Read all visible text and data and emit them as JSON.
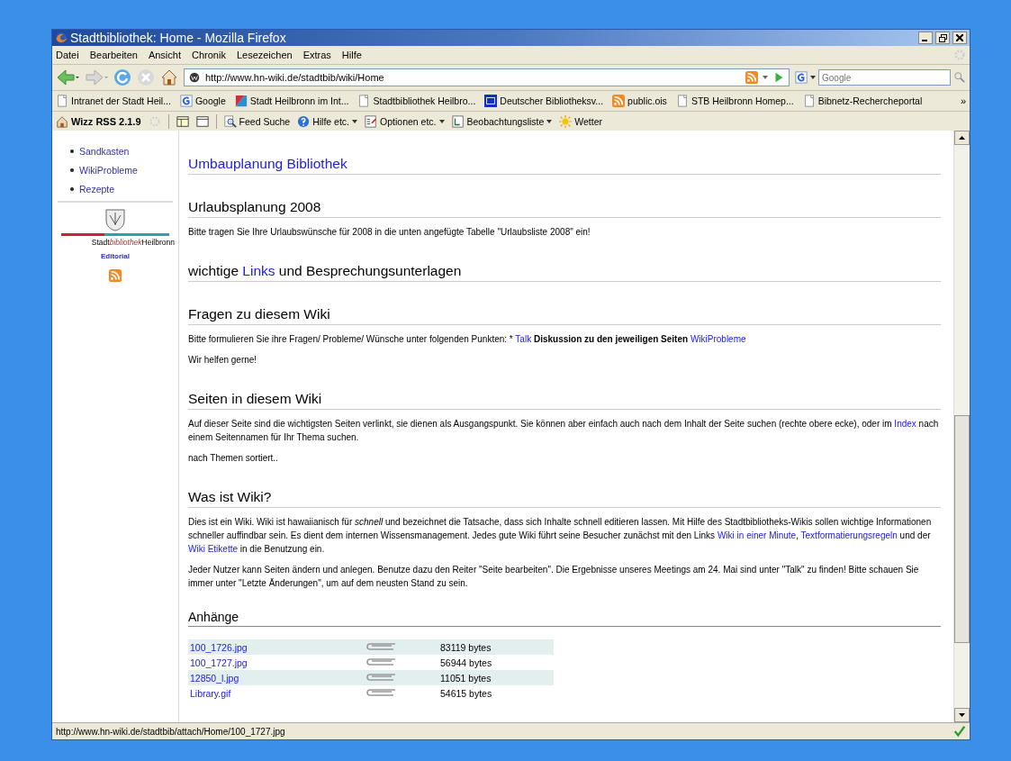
{
  "window": {
    "title": "Stadtbibliothek: Home - Mozilla Firefox"
  },
  "menu": [
    "Datei",
    "Bearbeiten",
    "Ansicht",
    "Chronik",
    "Lesezeichen",
    "Extras",
    "Hilfe"
  ],
  "navigation": {
    "url": "http://www.hn-wiki.de/stadtbib/wiki/Home",
    "search_placeholder": "Google"
  },
  "bookmarks": [
    {
      "label": "Intranet der Stadt Heil...",
      "kind": "page"
    },
    {
      "label": "Google",
      "kind": "google"
    },
    {
      "label": "Stadt Heilbronn im Int...",
      "kind": "flag"
    },
    {
      "label": "Stadtbibliothek Heilbro...",
      "kind": "page"
    },
    {
      "label": "Deutscher Bibliotheksv...",
      "kind": "dbv"
    },
    {
      "label": "public.ois",
      "kind": "rss"
    },
    {
      "label": "STB Heilbronn Homep...",
      "kind": "page"
    },
    {
      "label": "Bibnetz-Rechercheportal",
      "kind": "page"
    }
  ],
  "bookmarks_more": "»",
  "toolbar": [
    {
      "label": "Wizz RSS 2.1.9",
      "kind": "home",
      "dropdown": false
    },
    {
      "label": "Feed Suche",
      "kind": "search",
      "dropdown": false
    },
    {
      "label": "Hilfe etc.",
      "kind": "help",
      "dropdown": true
    },
    {
      "label": "Optionen etc.",
      "kind": "options",
      "dropdown": true
    },
    {
      "label": "Beobachtungsliste",
      "kind": "list",
      "dropdown": true
    },
    {
      "label": "Wetter",
      "kind": "sun",
      "dropdown": false
    }
  ],
  "sidebar": {
    "items": [
      "Sandkasten",
      "WikiProbleme",
      "Rezepte"
    ],
    "logo_text": [
      {
        "kind": "text",
        "text": "Stadt"
      },
      {
        "kind": "italic",
        "text": "bibliothek"
      },
      {
        "kind": "text",
        "text": "Heilbronn"
      }
    ],
    "editorial": "Editorial"
  },
  "sections": [
    {
      "kind": "heading",
      "segments": [
        {
          "kind": "link",
          "text": "Umbauplanung Bibliothek"
        }
      ]
    },
    {
      "kind": "heading",
      "segments": [
        {
          "kind": "text",
          "text": "Urlaubsplanung 2008"
        }
      ]
    },
    {
      "kind": "paragraph",
      "segments": [
        {
          "kind": "text",
          "text": "Bitte tragen Sie Ihre Urlaubswünsche für 2008 in die unten angefügte Tabelle \"Urlaubsliste 2008\" ein!"
        }
      ]
    },
    {
      "kind": "heading",
      "segments": [
        {
          "kind": "text",
          "text": "wichtige "
        },
        {
          "kind": "link",
          "text": "Links"
        },
        {
          "kind": "text",
          "text": " und Besprechungsunterlagen"
        }
      ]
    },
    {
      "kind": "heading",
      "segments": [
        {
          "kind": "text",
          "text": "Fragen zu diesem Wiki"
        }
      ]
    },
    {
      "kind": "paragraph",
      "segments": [
        {
          "kind": "text",
          "text": "Bitte formulieren Sie ihre Fragen/ Probleme/ Wünsche unter folgenden Punkten: * "
        },
        {
          "kind": "link",
          "text": "Talk"
        },
        {
          "kind": "bold",
          "text": " Diskussion zu den jeweiligen Seiten "
        },
        {
          "kind": "link",
          "text": "WikiProbleme"
        }
      ]
    },
    {
      "kind": "paragraph",
      "segments": [
        {
          "kind": "text",
          "text": "Wir helfen gerne!"
        }
      ]
    },
    {
      "kind": "heading",
      "segments": [
        {
          "kind": "text",
          "text": "Seiten in diesem Wiki"
        }
      ]
    },
    {
      "kind": "paragraph",
      "segments": [
        {
          "kind": "text",
          "text": "Auf dieser Seite sind die wichtigsten Seiten verlinkt, sie dienen als Ausgangspunkt. Sie können aber einfach auch nach dem Inhalt der Seite suchen (rechte obere ecke), oder im "
        },
        {
          "kind": "link",
          "text": "Index"
        },
        {
          "kind": "text",
          "text": " nach einem Seitennamen für Ihr Thema suchen."
        }
      ]
    },
    {
      "kind": "paragraph",
      "segments": [
        {
          "kind": "text",
          "text": "nach Themen sortiert.."
        }
      ]
    },
    {
      "kind": "heading",
      "segments": [
        {
          "kind": "text",
          "text": "Was ist Wiki?"
        }
      ]
    },
    {
      "kind": "paragraph",
      "segments": [
        {
          "kind": "text",
          "text": "Dies ist ein Wiki. Wiki ist hawaiianisch für "
        },
        {
          "kind": "italic",
          "text": "schnell"
        },
        {
          "kind": "text",
          "text": " und bezeichnet die Tatsache, dass sich Inhalte schnell editieren lassen. Mit Hilfe des Stadtbibliotheks-Wikis sollen wichtige Informationen schneller auffindbar sein. Es dient dem internen Wissensmanagement. Jedes gute Wiki führt seine Besucher zunächst mit den Links "
        },
        {
          "kind": "link",
          "text": "Wiki in einer Minute"
        },
        {
          "kind": "text",
          "text": ", "
        },
        {
          "kind": "link",
          "text": "Textformatierungsregeln"
        },
        {
          "kind": "text",
          "text": " und der "
        },
        {
          "kind": "link",
          "text": "Wiki Etikette"
        },
        {
          "kind": "text",
          "text": " in die Benutzung ein."
        }
      ]
    },
    {
      "kind": "paragraph",
      "segments": [
        {
          "kind": "text",
          "text": "Jeder Nutzer kann Seiten ändern und anlegen. Benutze dazu den Reiter \"Seite bearbeiten\". Die Ergebnisse unseres Meetings am 24. Mai sind unter \"Talk\" zu finden! Bitte schauen Sie immer unter \"Letzte Änderungen\", um auf dem neusten Stand zu sein."
        }
      ]
    },
    {
      "kind": "subheading",
      "segments": [
        {
          "kind": "text",
          "text": "Anhänge"
        }
      ]
    }
  ],
  "attachments": [
    {
      "name": "100_1726.jpg",
      "size": "83119 bytes"
    },
    {
      "name": "100_1727.jpg",
      "size": "56944 bytes"
    },
    {
      "name": "12850_l.jpg",
      "size": "11051 bytes"
    },
    {
      "name": "Library.gif",
      "size": "54615 bytes"
    }
  ],
  "status_bar": {
    "text": "http://www.hn-wiki.de/stadtbib/attach/Home/100_1727.jpg"
  }
}
